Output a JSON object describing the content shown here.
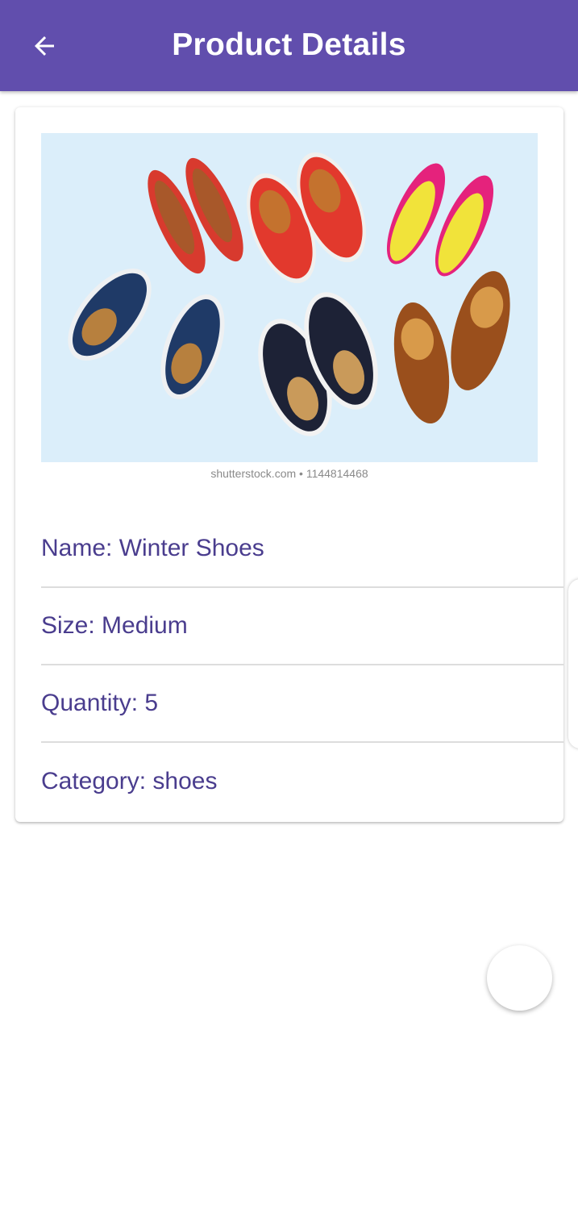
{
  "app_bar": {
    "title": "Product Details",
    "back_icon": "arrow-left-icon",
    "background_color": "#614ead"
  },
  "product": {
    "image_caption": "shutterstock.com • 1144814468",
    "details": [
      {
        "label": "Name: Winter Shoes"
      },
      {
        "label": "Size: Medium"
      },
      {
        "label": "Quantity: 5"
      },
      {
        "label": "Category: shoes"
      }
    ],
    "text_color": "#4a3d8e"
  },
  "fab": {
    "icon": "blank-circle"
  }
}
